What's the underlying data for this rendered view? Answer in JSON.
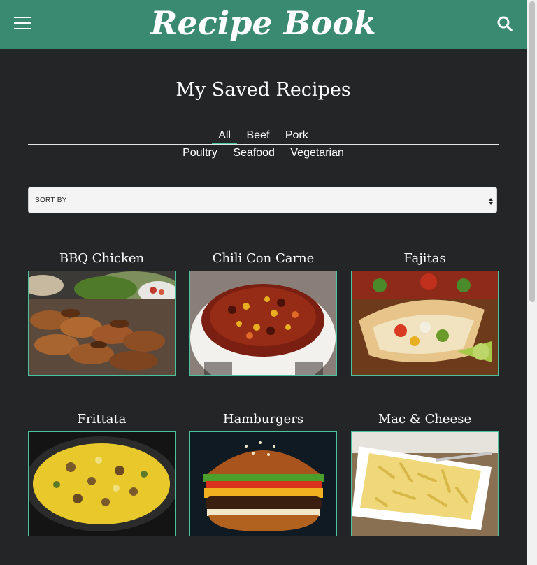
{
  "header": {
    "logo": "Recipe Book",
    "menu_icon": "hamburger-menu-icon",
    "search_icon": "search-icon",
    "background": "#3a8a72"
  },
  "page_title": "My Saved Recipes",
  "tabs": {
    "row1": [
      "All",
      "Beef",
      "Pork"
    ],
    "row2": [
      "Poultry",
      "Seafood",
      "Vegetarian"
    ],
    "active": "All",
    "accent": "#49c49e"
  },
  "sort": {
    "label": "SORT BY"
  },
  "recipes": [
    {
      "title": "BBQ Chicken",
      "image": "bbq-chicken-photo"
    },
    {
      "title": "Chili Con Carne",
      "image": "chili-con-carne-photo"
    },
    {
      "title": "Fajitas",
      "image": "fajitas-photo"
    },
    {
      "title": "Frittata",
      "image": "frittata-photo"
    },
    {
      "title": "Hamburgers",
      "image": "hamburgers-photo"
    },
    {
      "title": "Mac & Cheese",
      "image": "mac-and-cheese-photo"
    }
  ]
}
